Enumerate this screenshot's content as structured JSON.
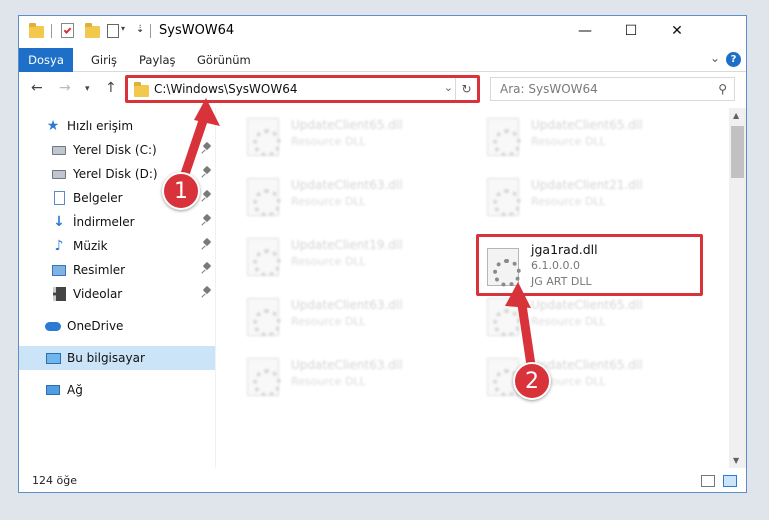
{
  "window": {
    "title": "SysWOW64",
    "controls": {
      "minimize": "—",
      "maximize": "☐",
      "close": "✕"
    }
  },
  "ribbon": {
    "file_tab": "Dosya",
    "tabs": [
      "Giriş",
      "Paylaş",
      "Görünüm"
    ],
    "help": "?"
  },
  "address": {
    "path": "C:\\Windows\\SysWOW64",
    "search_placeholder": "Ara: SysWOW64"
  },
  "sidebar": {
    "quick_access": "Hızlı erişim",
    "items": [
      {
        "label": "Yerel Disk (C:)",
        "icon": "drive-icon",
        "pinned": true
      },
      {
        "label": "Yerel Disk (D:)",
        "icon": "drive-icon",
        "pinned": true
      },
      {
        "label": "Belgeler",
        "icon": "document-icon",
        "pinned": true
      },
      {
        "label": "İndirmeler",
        "icon": "download-icon",
        "pinned": true
      },
      {
        "label": "Müzik",
        "icon": "music-icon",
        "pinned": true
      },
      {
        "label": "Resimler",
        "icon": "pictures-icon",
        "pinned": true
      },
      {
        "label": "Videolar",
        "icon": "video-icon",
        "pinned": true
      }
    ],
    "onedrive": "OneDrive",
    "this_pc": "Bu bilgisayar",
    "network": "Ağ"
  },
  "files": {
    "left": [
      {
        "name": "UpdateClient65.dll",
        "desc": "Resource DLL"
      },
      {
        "name": "UpdateClient63.dll",
        "desc": "Resource DLL"
      },
      {
        "name": "UpdateClient19.dll",
        "desc": "Resource DLL"
      },
      {
        "name": "UpdateClient63.dll",
        "desc": "Resource DLL"
      },
      {
        "name": "UpdateClient63.dll",
        "desc": "Resource DLL"
      }
    ],
    "right": [
      {
        "name": "UpdateClient65.dll",
        "desc": "Resource DLL"
      },
      {
        "name": "UpdateClient21.dll",
        "desc": "Resource DLL"
      },
      {
        "name": "UpdateClient65.dll",
        "desc": "Resource DLL"
      },
      {
        "name": "UpdateClient65.dll",
        "desc": "Resource DLL"
      }
    ],
    "highlighted": {
      "name": "jga1rad.dll",
      "version": "6.1.0.0.0",
      "desc": "JG ART DLL"
    }
  },
  "status": {
    "count": "124 öğe"
  },
  "callouts": {
    "first": "1",
    "second": "2"
  },
  "colors": {
    "accent": "#1e6fc8",
    "highlight": "#d8323a",
    "selected": "#cce4f7"
  }
}
